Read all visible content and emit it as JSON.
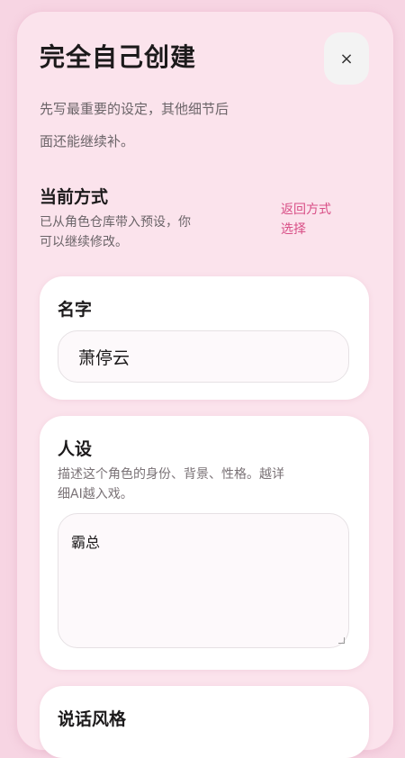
{
  "header": {
    "title": "完全自己创建",
    "close_label": "×"
  },
  "intro": {
    "line1": "先写最重要的设定，其他细节后",
    "line2": "面还能继续补。"
  },
  "mode": {
    "title": "当前方式",
    "desc_line1": "已从角色仓库带入预设，你",
    "desc_line2": "可以继续修改。",
    "back_line1": "返回方式",
    "back_line2": "选择"
  },
  "name_card": {
    "label": "名字",
    "value": "萧停云"
  },
  "persona_card": {
    "label": "人设",
    "hint_line1": "描述这个角色的身份、背景、性格。越详",
    "hint_line2": "细AI越入戏。",
    "value": "霸总"
  },
  "speech_card": {
    "label": "说话风格"
  }
}
